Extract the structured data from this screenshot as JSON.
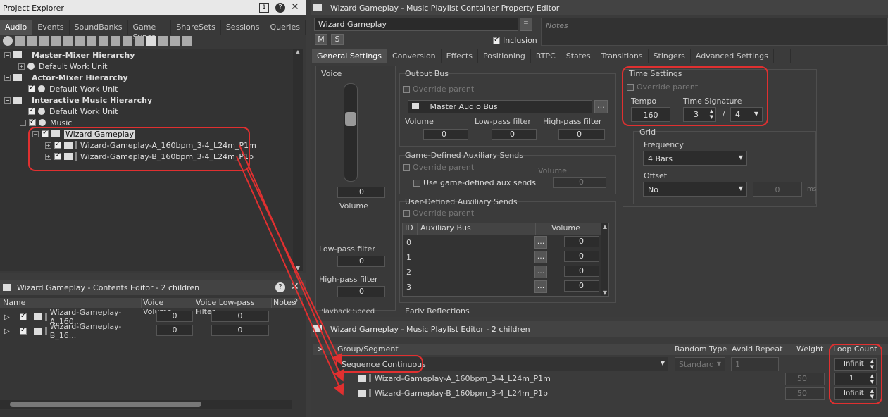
{
  "project_explorer": {
    "title": "Project Explorer",
    "tabs": [
      "Audio",
      "Events",
      "SoundBanks",
      "Game Syncs",
      "ShareSets",
      "Sessions",
      "Queries"
    ],
    "tree": {
      "master_mixer": "Master-Mixer Hierarchy",
      "default_work_unit_1": "Default Work Unit",
      "actor_mixer": "Actor-Mixer Hierarchy",
      "default_work_unit_2": "Default Work Unit",
      "interactive_music": "Interactive Music Hierarchy",
      "default_work_unit_3": "Default Work Unit",
      "music": "Music",
      "wizard_gameplay": "Wizard Gameplay",
      "segment_a": "Wizard-Gameplay-A_160bpm_3-4_L24m_P1m",
      "segment_b": "Wizard-Gameplay-B_160bpm_3-4_L24m_P1b"
    }
  },
  "contents_editor": {
    "title": "Wizard Gameplay - Contents Editor - 2 children",
    "columns": [
      "Name",
      "Voice Volume",
      "Voice Low-pass Filter",
      "Notes"
    ],
    "rows": [
      {
        "name": "Wizard-Gameplay-A_160...",
        "volume": "0",
        "lpf": "0"
      },
      {
        "name": "Wizard-Gameplay-B_16...",
        "volume": "0",
        "lpf": "0"
      }
    ]
  },
  "property_editor": {
    "title": "Wizard Gameplay - Music Playlist Container Property Editor",
    "name_value": "Wizard Gameplay",
    "m_label": "M",
    "s_label": "S",
    "inclusion_label": "Inclusion",
    "notes_placeholder": "Notes",
    "tabs": [
      "General Settings",
      "Conversion",
      "Effects",
      "Positioning",
      "RTPC",
      "States",
      "Transitions",
      "Stingers",
      "Advanced Settings",
      "+"
    ],
    "voice": {
      "label": "Voice",
      "volume_value": "0",
      "volume_label": "Volume",
      "lpf_label": "Low-pass filter",
      "lpf_value": "0",
      "hpf_label": "High-pass filter",
      "hpf_value": "0",
      "playback_label": "Playback Speed"
    },
    "output_bus": {
      "title": "Output Bus",
      "override": "Override parent",
      "bus_name": "Master Audio Bus",
      "browse": "...",
      "volume_label": "Volume",
      "volume_value": "0",
      "lpf_label": "Low-pass filter",
      "lpf_value": "0",
      "hpf_label": "High-pass filter",
      "hpf_value": "0"
    },
    "game_aux": {
      "title": "Game-Defined Auxiliary Sends",
      "override": "Override parent",
      "use_label": "Use game-defined aux sends",
      "volume_label": "Volume",
      "volume_value": "0"
    },
    "user_aux": {
      "title": "User-Defined Auxiliary Sends",
      "override": "Override parent",
      "col_id": "ID",
      "col_bus": "Auxiliary Bus",
      "col_volume": "Volume",
      "rows": [
        {
          "id": "0",
          "volume": "0"
        },
        {
          "id": "1",
          "volume": "0"
        },
        {
          "id": "2",
          "volume": "0"
        },
        {
          "id": "3",
          "volume": "0"
        }
      ]
    },
    "early_reflections": "Early Reflections",
    "time_settings": {
      "title": "Time Settings",
      "override": "Override parent",
      "tempo_label": "Tempo",
      "tempo_value": "160",
      "sig_label": "Time Signature",
      "sig_num": "3",
      "sig_slash": "/",
      "sig_den": "4"
    },
    "grid": {
      "title": "Grid",
      "frequency_label": "Frequency",
      "frequency_value": "4 Bars",
      "offset_label": "Offset",
      "offset_value": "No",
      "offset_num": "0",
      "offset_unit": "ms"
    }
  },
  "playlist_editor": {
    "title": "Wizard Gameplay - Music Playlist Editor - 2 children",
    "expand": ">",
    "columns": [
      "Group/Segment",
      "Random Type",
      "Avoid Repeat",
      "Weight",
      "Loop Count"
    ],
    "group": {
      "name": "Sequence Continuous",
      "random_type": "Standard",
      "avoid_repeat": "1",
      "loop": "Infinit"
    },
    "items": [
      {
        "name": "Wizard-Gameplay-A_160bpm_3-4_L24m_P1m",
        "weight": "50",
        "loop": "1"
      },
      {
        "name": "Wizard-Gameplay-B_160bpm_3-4_L24m_P1b",
        "weight": "50",
        "loop": "Infinit"
      }
    ]
  },
  "colors": {
    "accent_red": "#e03030",
    "panel": "#3d3d3d",
    "field": "#2c2c2c"
  }
}
